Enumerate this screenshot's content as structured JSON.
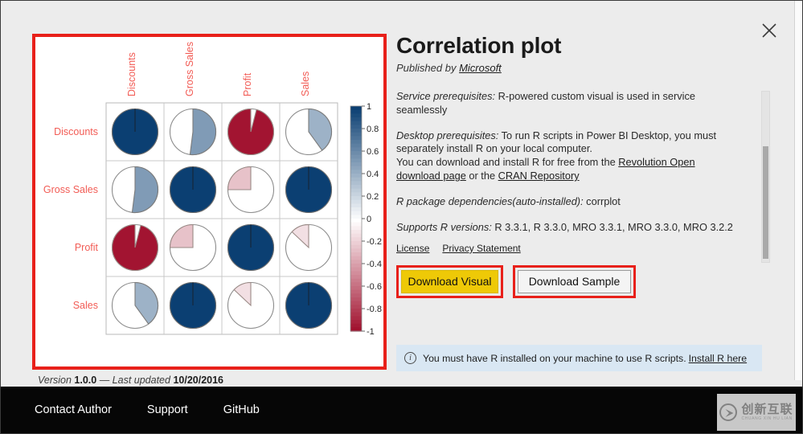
{
  "header": {
    "title": "Correlation plot",
    "published_prefix": "Published by ",
    "publisher": "Microsoft",
    "close_icon": "close-icon"
  },
  "body": {
    "service_prereq_label": "Service prerequisites:",
    "service_prereq_text": " R-powered custom visual is used in service seamlessly",
    "desktop_prereq_label": "Desktop prerequisites:",
    "desktop_prereq_text": " To run R scripts in Power BI Desktop, you must separately install R on your local computer.",
    "desktop_prereq_text2": "You can download and install R for free from the ",
    "link_revolution": "Revolution Open download page",
    "desktop_prereq_text3": " or the ",
    "link_cran": "CRAN Repository",
    "deps_label": "R package dependencies(auto-installed):",
    "deps_text": " corrplot",
    "versions_label": "Supports R versions:",
    "versions_text": " R 3.3.1, R 3.3.0, MRO 3.3.1, MRO 3.3.0, MRO 3.2.2",
    "link_license": "License",
    "link_privacy": "Privacy Statement"
  },
  "buttons": {
    "download_visual": "Download Visual",
    "download_sample": "Download Sample",
    "visual_color": "#eec907",
    "sample_color": "#f4f4f4",
    "highlight_color": "#e8201a"
  },
  "info": {
    "icon": "info-icon",
    "text": "You must have R installed on your machine to use R scripts.",
    "link": "Install R here"
  },
  "version": {
    "prefix": "Version ",
    "number": "1.0.0",
    "dash": " — ",
    "updated_label": "Last updated ",
    "updated_date": "10/20/2016"
  },
  "footer": {
    "links": [
      "Contact Author",
      "Support",
      "GitHub"
    ]
  },
  "watermark": {
    "cn": "创新互联",
    "pinyin": "CHUANG XIN HU LIAN"
  },
  "chart_data": {
    "type": "heatmap",
    "title": "",
    "variables": [
      "Discounts",
      "Gross Sales",
      "Profit",
      "Sales"
    ],
    "matrix": [
      [
        1.0,
        0.52,
        -0.96,
        0.4
      ],
      [
        0.52,
        1.0,
        -0.25,
        1.0
      ],
      [
        -0.96,
        -0.25,
        1.0,
        -0.13
      ],
      [
        0.4,
        1.0,
        -0.13,
        1.0
      ]
    ],
    "glyph": "pie",
    "colorbar": {
      "ticks": [
        1,
        0.8,
        0.6,
        0.4,
        0.2,
        0,
        -0.2,
        -0.4,
        -0.6,
        -0.8,
        -1
      ],
      "tick_labels": [
        "1",
        "0.8",
        "0.6",
        "0.4",
        "0.2",
        "0",
        "-0.2",
        "-0.4",
        "-0.6",
        "-0.8",
        "-1"
      ],
      "range": [
        -1,
        1
      ],
      "high_color": "#0b3f72",
      "mid_color": "#ffffff",
      "low_color": "#9e0a28",
      "position": "right"
    },
    "label_color": "#f25c55",
    "grid": true
  }
}
